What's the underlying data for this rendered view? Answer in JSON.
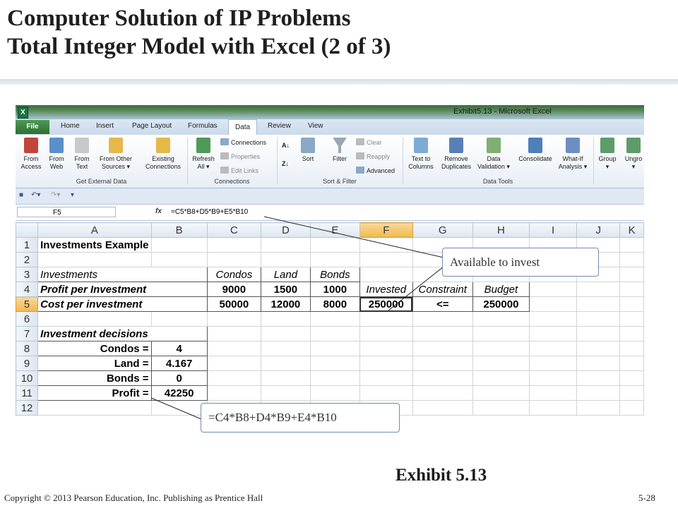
{
  "slide": {
    "title_line1": "Computer Solution of IP Problems",
    "title_line2": "Total Integer Model with Excel (2 of 3)",
    "exhibit": "Exhibit 5.13",
    "copyright": "Copyright © 2013 Pearson Education, Inc. Publishing as Prentice Hall",
    "page_number": "5-28"
  },
  "excel": {
    "window_title": "Exhibit5.13 - Microsoft Excel",
    "logo": "X",
    "tabs": [
      "File",
      "Home",
      "Insert",
      "Page Layout",
      "Formulas",
      "Data",
      "Review",
      "View"
    ],
    "active_tab": "Data",
    "ribbon": {
      "from_access": "From\nAccess",
      "from_web": "From\nWeb",
      "from_text": "From\nText",
      "from_other": "From Other\nSources ▾",
      "existing": "Existing\nConnections",
      "refresh": "Refresh\nAll ▾",
      "connections": "Connections",
      "properties": "Properties",
      "edit_links": "Edit Links",
      "sort": "Sort",
      "filter": "Filter",
      "clear": "Clear",
      "reapply": "Reapply",
      "advanced": "Advanced",
      "text_to_columns": "Text to\nColumns",
      "remove_duplicates": "Remove\nDuplicates",
      "data_validation": "Data\nValidation ▾",
      "consolidate": "Consolidate",
      "what_if": "What-If\nAnalysis ▾",
      "group": "Group\n▾",
      "ungroup": "Ungro\n▾",
      "group_labels": [
        "Get External Data",
        "Connections",
        "Sort & Filter",
        "Data Tools"
      ]
    },
    "name_box": "F5",
    "fx": "fx",
    "formula": "=C5*B8+D5*B9+E5*B10",
    "columns": [
      "A",
      "B",
      "C",
      "D",
      "E",
      "F",
      "G",
      "H",
      "I",
      "J",
      "K"
    ],
    "rows": [
      "1",
      "2",
      "3",
      "4",
      "5",
      "6",
      "7",
      "8",
      "9",
      "10",
      "11",
      "12"
    ],
    "cells": {
      "a1": "Investments Example",
      "a3": "Investments",
      "c3": "Condos",
      "d3": "Land",
      "e3": "Bonds",
      "a4": "Profit per Investment",
      "c4": "9000",
      "d4": "1500",
      "e4": "1000",
      "f4": "Invested",
      "g4": "Constraint",
      "h4": "Budget",
      "a5": "Cost per investment",
      "c5": "50000",
      "d5": "12000",
      "e5": "8000",
      "f5": "250000",
      "g5": "<=",
      "h5": "250000",
      "a7": "Investment decisions",
      "a8": "Condos =",
      "b8": "4",
      "a9": "Land =",
      "b9": "4.167",
      "a10": "Bonds =",
      "b10": "0",
      "a11": "Profit =",
      "b11": "42250"
    }
  },
  "callouts": {
    "available": "Available to invest",
    "profit_formula": "=C4*B8+D4*B9+E4*B10"
  }
}
